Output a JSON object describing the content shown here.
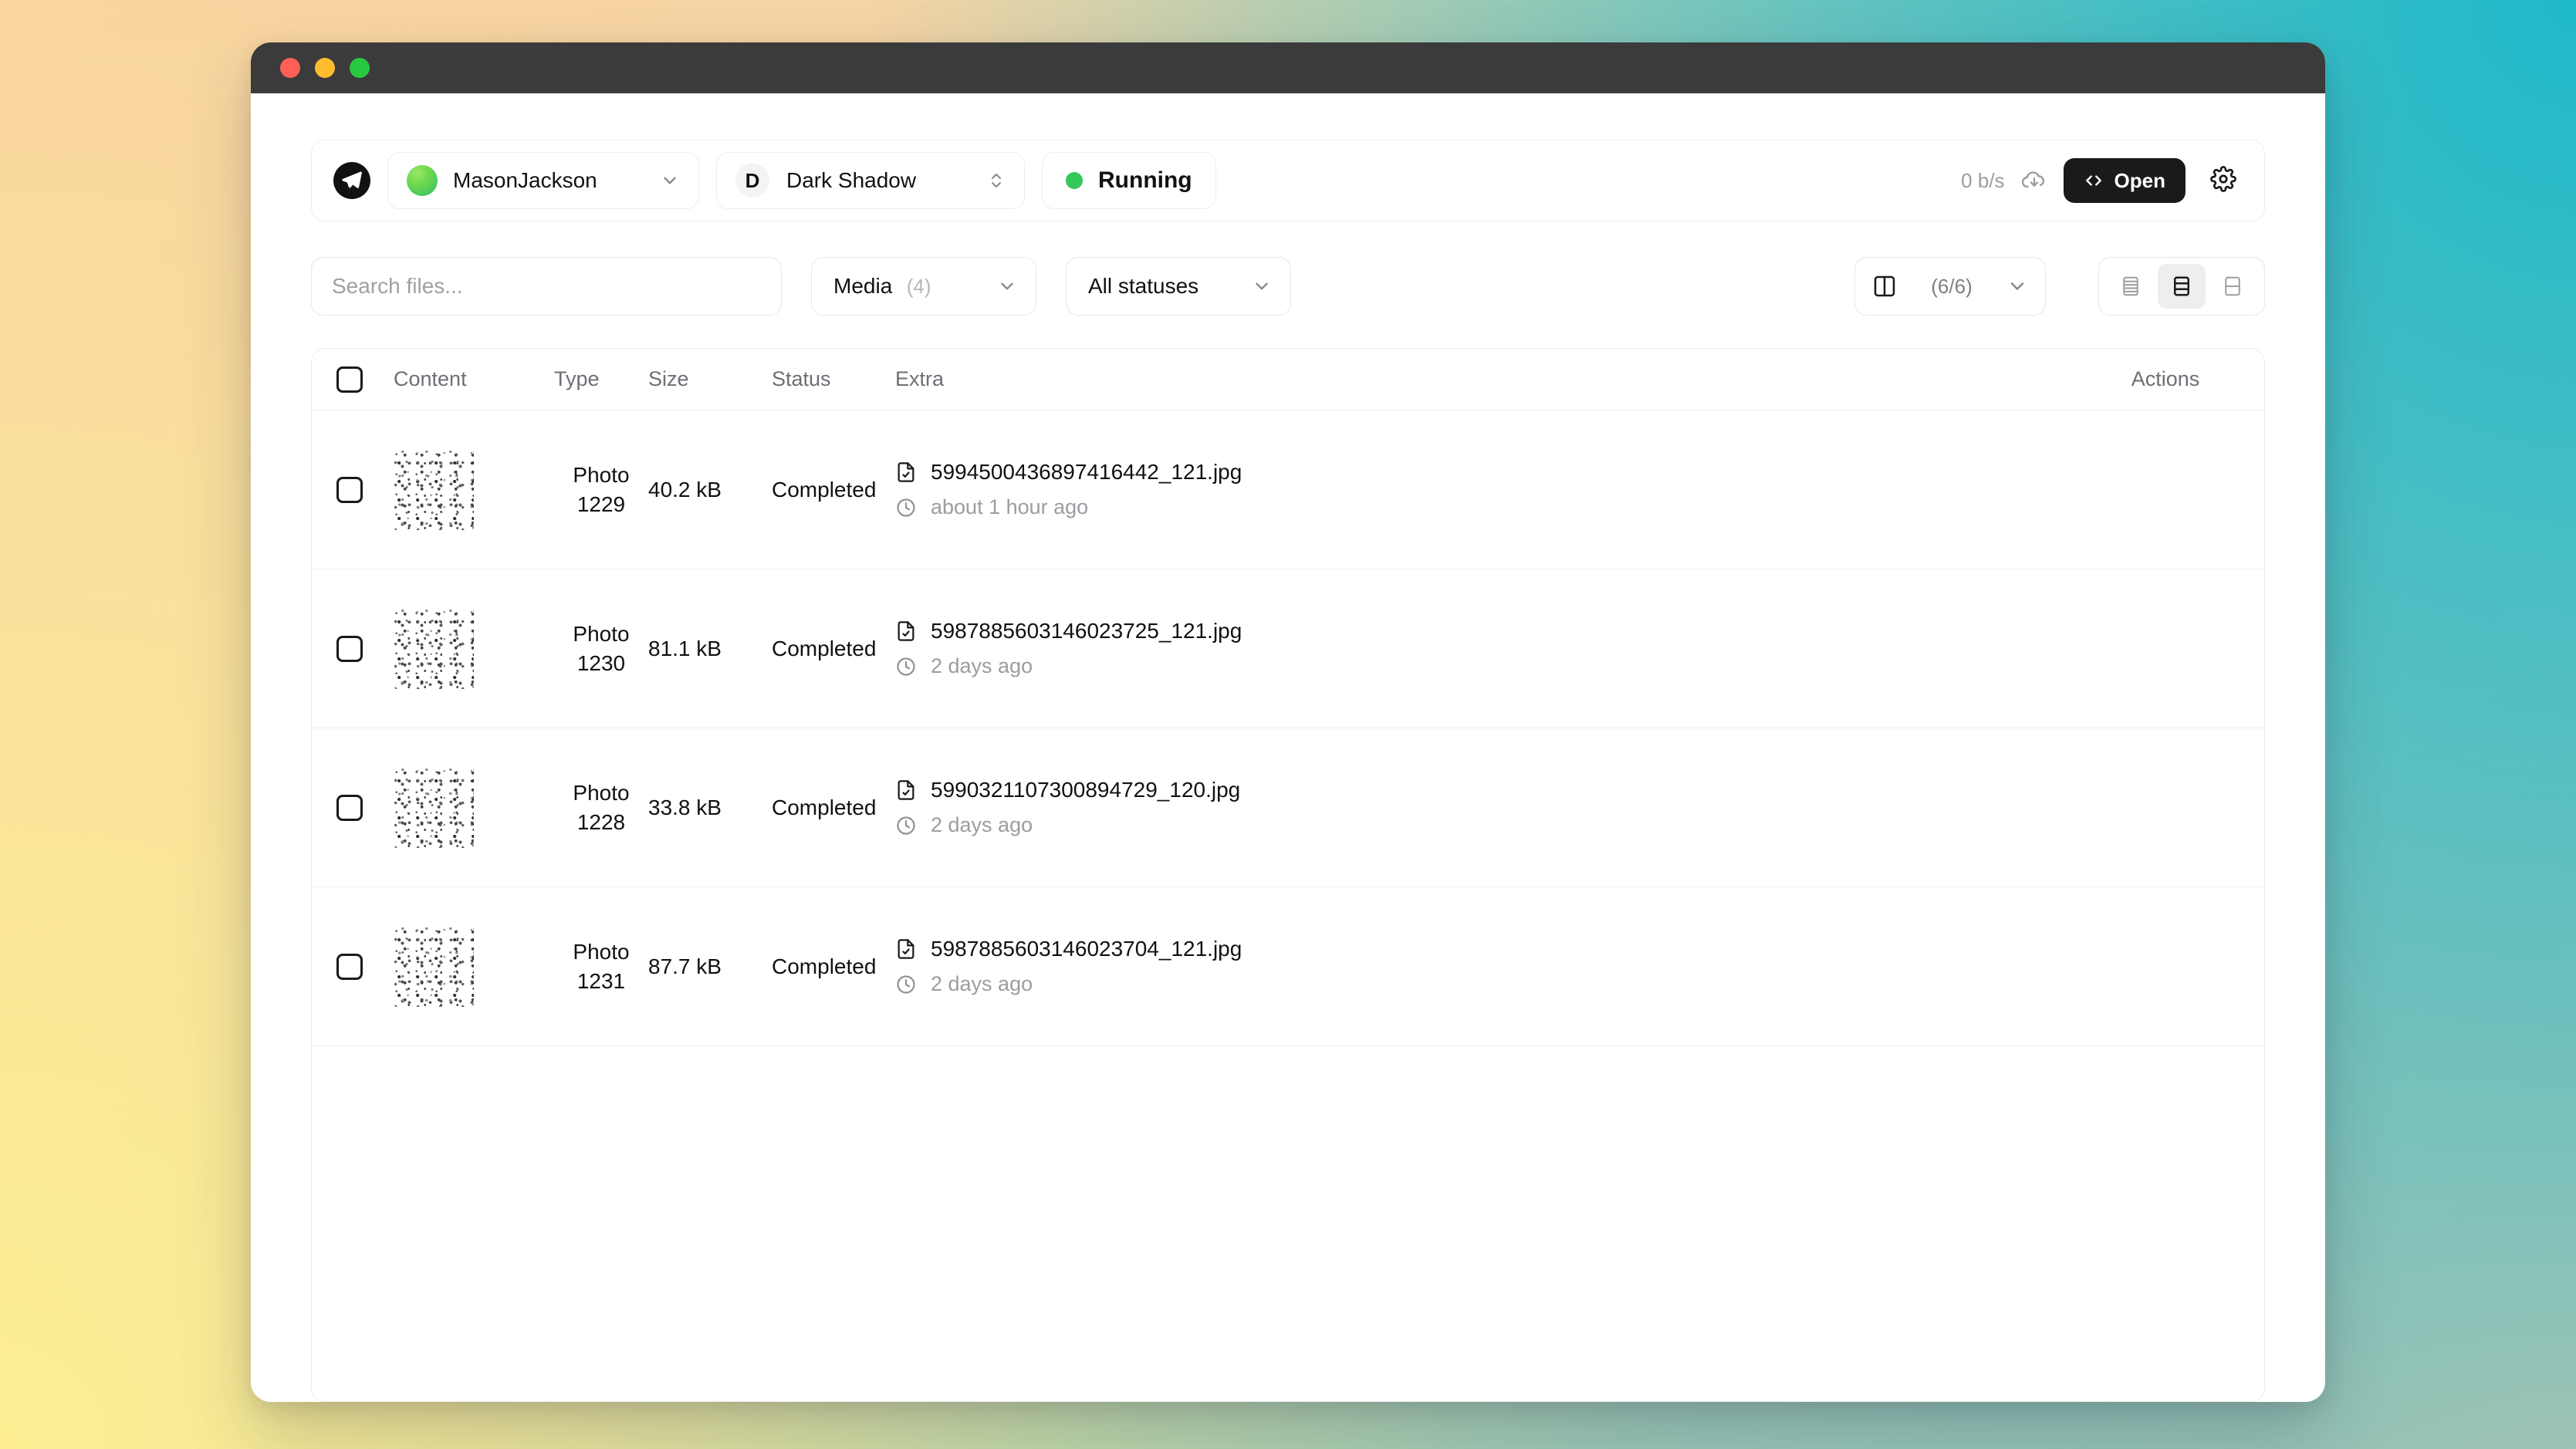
{
  "window": {
    "traffic_lights": [
      "close",
      "minimize",
      "maximize"
    ]
  },
  "topbar": {
    "logo_icon": "telegram-send-icon",
    "account": {
      "name": "MasonJackson",
      "avatar_icon": "account-avatar",
      "chevron_icon": "chevron-down-icon"
    },
    "profile": {
      "initial": "D",
      "name": "Dark Shadow",
      "chevron_icon": "chevron-up-down-icon"
    },
    "status": {
      "label": "Running",
      "dot_color": "#34c759"
    },
    "speed": "0 b/s",
    "speed_icon": "cloud-download-icon",
    "open_button": {
      "label": "Open",
      "icon": "code-brackets-icon"
    },
    "settings_icon": "gear-icon"
  },
  "filters": {
    "search": {
      "placeholder": "Search files...",
      "value": ""
    },
    "media": {
      "label": "Media",
      "count": "(4)",
      "chevron_icon": "chevron-down-icon"
    },
    "statuses": {
      "label": "All statuses",
      "chevron_icon": "chevron-down-icon"
    },
    "columns": {
      "icon": "panel-split-icon",
      "count": "(6/6)",
      "chevron_icon": "chevron-down-icon"
    },
    "density": [
      {
        "name": "density-compact",
        "icon": "rows-compact-icon",
        "active": false
      },
      {
        "name": "density-normal",
        "icon": "rows-normal-icon",
        "active": true
      },
      {
        "name": "density-comfortable",
        "icon": "rows-comfortable-icon",
        "active": false
      }
    ]
  },
  "table": {
    "headers": {
      "content": "Content",
      "type": "Type",
      "size": "Size",
      "status": "Status",
      "extra": "Extra",
      "actions": "Actions"
    },
    "rows": [
      {
        "thumbnail_icon": "photo-thumbnail",
        "type": "Photo",
        "type_id": "1229",
        "size": "40.2 kB",
        "status": "Completed",
        "filename": "5994500436897416442_121.jpg",
        "timeago": "about 1 hour ago",
        "file_icon": "file-check-icon",
        "clock_icon": "clock-icon"
      },
      {
        "thumbnail_icon": "photo-thumbnail",
        "type": "Photo",
        "type_id": "1230",
        "size": "81.1 kB",
        "status": "Completed",
        "filename": "5987885603146023725_121.jpg",
        "timeago": "2 days ago",
        "file_icon": "file-check-icon",
        "clock_icon": "clock-icon"
      },
      {
        "thumbnail_icon": "photo-thumbnail",
        "type": "Photo",
        "type_id": "1228",
        "size": "33.8 kB",
        "status": "Completed",
        "filename": "5990321107300894729_120.jpg",
        "timeago": "2 days ago",
        "file_icon": "file-check-icon",
        "clock_icon": "clock-icon"
      },
      {
        "thumbnail_icon": "photo-thumbnail",
        "type": "Photo",
        "type_id": "1231",
        "size": "87.7 kB",
        "status": "Completed",
        "filename": "5987885603146023704_121.jpg",
        "timeago": "2 days ago",
        "file_icon": "file-check-icon",
        "clock_icon": "clock-icon"
      }
    ]
  },
  "colors": {
    "accent_black": "#1a1a1a",
    "status_green": "#34c759",
    "muted_text": "#9a9da1",
    "border": "#ececed"
  }
}
